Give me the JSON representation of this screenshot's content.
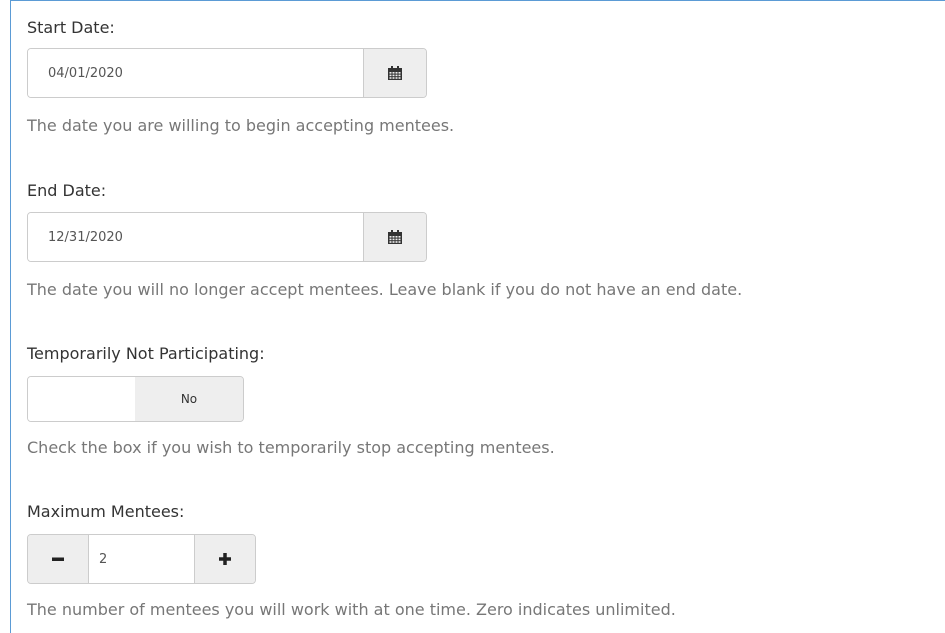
{
  "start_date": {
    "label": "Start Date:",
    "value": "04/01/2020",
    "help": "The date you are willing to begin accepting mentees.",
    "icon": "calendar-icon"
  },
  "end_date": {
    "label": "End Date:",
    "value": "12/31/2020",
    "help": "The date you will no longer accept mentees. Leave blank if you do not have an end date.",
    "icon": "calendar-icon"
  },
  "not_participating": {
    "label": "Temporarily Not Participating:",
    "state_label": "No",
    "help": "Check the box if you wish to temporarily stop accepting mentees."
  },
  "max_mentees": {
    "label": "Maximum Mentees:",
    "value": "2",
    "decrement_icon": "minus-icon",
    "increment_icon": "plus-icon",
    "help": "The number of mentees you will work with at one time. Zero indicates unlimited."
  },
  "colors": {
    "frame_border": "#5b9bd5",
    "addon_bg": "#eeeeee",
    "input_border": "#cccccc",
    "help_text": "#777777"
  }
}
